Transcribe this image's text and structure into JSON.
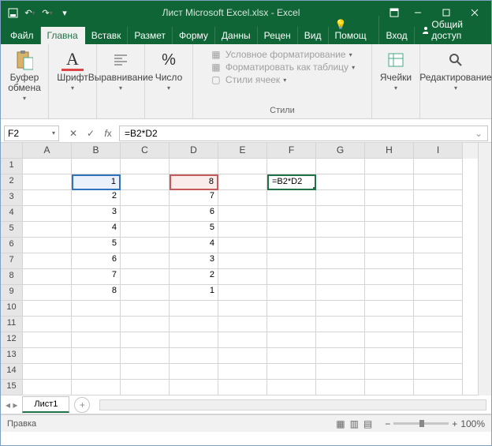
{
  "title": "Лист Microsoft Excel.xlsx - Excel",
  "qat": {
    "save": "save",
    "undo": "undo",
    "redo": "redo"
  },
  "tabs": {
    "file": "Файл",
    "home": "Главна",
    "insert": "Вставк",
    "layout": "Размет",
    "formulas": "Форму",
    "data": "Данны",
    "review": "Рецен",
    "view": "Вид",
    "help": "Помощ",
    "signin": "Вход",
    "share": "Общий доступ"
  },
  "ribbon": {
    "clipboard": {
      "label": "Буфер обмена",
      "paste": ""
    },
    "font": {
      "label": "Шрифт",
      "btn": "A"
    },
    "align": {
      "label": "Выравнивание"
    },
    "number": {
      "label": "Число",
      "btn": "%"
    },
    "styles": {
      "label": "Стили",
      "cond": "Условное форматирование",
      "table": "Форматировать как таблицу",
      "cells_style": "Стили ячеек"
    },
    "cells": {
      "label": "Ячейки"
    },
    "editing": {
      "label": "Редактирование"
    }
  },
  "namebox": "F2",
  "formula": "=B2*D2",
  "columns": [
    "A",
    "B",
    "C",
    "D",
    "E",
    "F",
    "G",
    "H",
    "I"
  ],
  "rows": [
    "1",
    "2",
    "3",
    "4",
    "5",
    "6",
    "7",
    "8",
    "9",
    "10",
    "11",
    "12",
    "13",
    "14",
    "15"
  ],
  "cells": {
    "B2": "1",
    "B3": "2",
    "B4": "3",
    "B5": "4",
    "B6": "5",
    "B7": "6",
    "B8": "7",
    "B9": "8",
    "D2": "8",
    "D3": "7",
    "D4": "6",
    "D5": "5",
    "D6": "4",
    "D7": "3",
    "D8": "2",
    "D9": "1",
    "F2": "=B2*D2"
  },
  "sheet_tab": "Лист1",
  "status": "Правка",
  "zoom": "100%",
  "chart_data": {
    "type": "table",
    "columns": [
      "B",
      "D"
    ],
    "rows": [
      {
        "B": 1,
        "D": 8
      },
      {
        "B": 2,
        "D": 7
      },
      {
        "B": 3,
        "D": 6
      },
      {
        "B": 4,
        "D": 5
      },
      {
        "B": 5,
        "D": 4
      },
      {
        "B": 6,
        "D": 3
      },
      {
        "B": 7,
        "D": 2
      },
      {
        "B": 8,
        "D": 1
      }
    ],
    "formula": {
      "cell": "F2",
      "expr": "=B2*D2"
    }
  }
}
